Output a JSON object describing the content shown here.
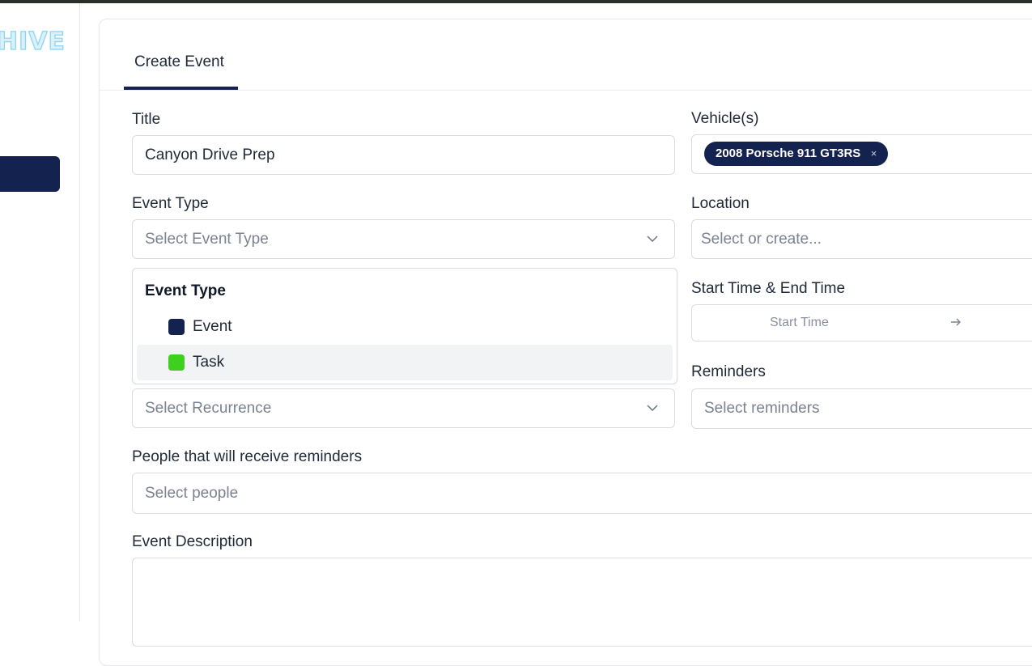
{
  "sidebar": {
    "logo_text": "HIVE"
  },
  "tabs": [
    {
      "label": "Create Event"
    }
  ],
  "form": {
    "title": {
      "label": "Title",
      "value": "Canyon Drive Prep"
    },
    "vehicles": {
      "label": "Vehicle(s)",
      "chips": [
        "2008 Porsche 911 GT3RS"
      ],
      "chip_remove": "×"
    },
    "event_type": {
      "label": "Event Type",
      "placeholder": "Select Event Type",
      "dropdown_title": "Event Type",
      "options": [
        {
          "label": "Event",
          "color": "#13224f"
        },
        {
          "label": "Task",
          "color": "#3ecf1f"
        }
      ],
      "highlighted_option": "Task"
    },
    "location": {
      "label": "Location",
      "placeholder": "Select or create..."
    },
    "time": {
      "label": "Start Time & End Time",
      "start_placeholder": "Start Time"
    },
    "recurrence": {
      "placeholder": "Select Recurrence"
    },
    "reminders": {
      "label": "Reminders",
      "placeholder": "Select reminders"
    },
    "people": {
      "label": "People that will receive reminders",
      "placeholder": "Select people"
    },
    "description": {
      "label": "Event Description"
    }
  },
  "colors": {
    "primary": "#13224f",
    "task_green": "#3ecf1f",
    "logo_blue": "#8fd3f0"
  }
}
